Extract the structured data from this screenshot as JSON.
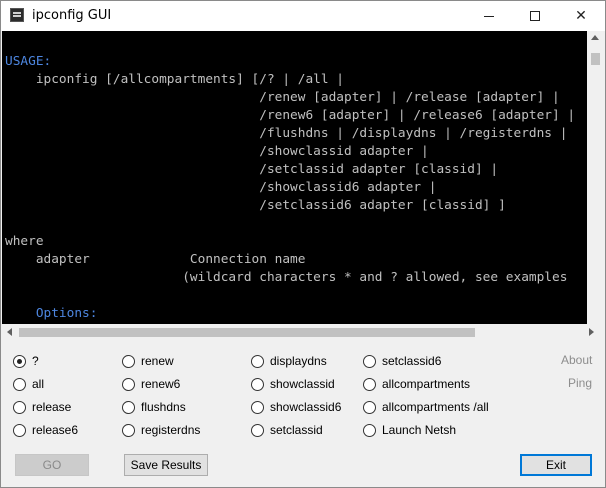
{
  "window": {
    "title": "ipconfig GUI"
  },
  "console_lines": [
    "USAGE:",
    "    ipconfig [/allcompartments] [/? | /all |",
    "                                 /renew [adapter] | /release [adapter] |",
    "                                 /renew6 [adapter] | /release6 [adapter] |",
    "                                 /flushdns | /displaydns | /registerdns |",
    "                                 /showclassid adapter |",
    "                                 /setclassid adapter [classid] |",
    "                                 /showclassid6 adapter |",
    "                                 /setclassid6 adapter [classid] ]",
    "",
    "where",
    "    adapter             Connection name",
    "                       (wildcard characters * and ? allowed, see examples",
    "",
    "    Options:"
  ],
  "options": {
    "col1": [
      "?",
      "all",
      "release",
      "release6"
    ],
    "col2": [
      "renew",
      "renew6",
      "flushdns",
      "registerdns"
    ],
    "col3": [
      "displaydns",
      "showclassid",
      "showclassid6",
      "setclassid"
    ],
    "col4": [
      "setclassid6",
      "allcompartments",
      "allcompartments /all",
      "Launch Netsh"
    ],
    "selected": "?"
  },
  "links": {
    "about": "About",
    "ping": "Ping"
  },
  "buttons": {
    "go": "GO",
    "save": "Save Results",
    "exit": "Exit"
  },
  "colors": {
    "console_bg": "#000000",
    "console_text": "#c0c0c0",
    "console_highlight": "#4d86e0"
  }
}
